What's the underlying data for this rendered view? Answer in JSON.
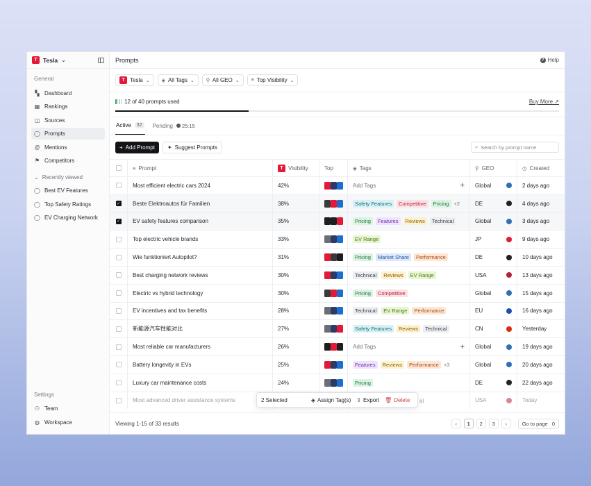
{
  "sidebar": {
    "org": {
      "name": "Tesla",
      "logo_letter": "T"
    },
    "general_title": "General",
    "nav": [
      {
        "label": "Dashboard",
        "icon": "dashboard-icon",
        "glyph": "▚"
      },
      {
        "label": "Rankings",
        "icon": "rankings-icon",
        "glyph": "▦"
      },
      {
        "label": "Sources",
        "icon": "sources-icon",
        "glyph": "◫"
      },
      {
        "label": "Prompts",
        "icon": "chat-icon",
        "glyph": "◯",
        "active": true
      },
      {
        "label": "Mentions",
        "icon": "at-icon",
        "glyph": "@"
      },
      {
        "label": "Competitors",
        "icon": "flag-icon",
        "glyph": "⚑"
      }
    ],
    "recent_title": "Recently viewed",
    "recent": [
      {
        "label": "Best EV Features"
      },
      {
        "label": "Top Safety Ratings"
      },
      {
        "label": "EV Charging Network"
      }
    ],
    "settings_title": "Settings",
    "settings": [
      {
        "label": "Team",
        "icon": "team-icon",
        "glyph": "⚇"
      },
      {
        "label": "Workspace",
        "icon": "globe-icon",
        "glyph": "◍"
      }
    ]
  },
  "header": {
    "title": "Prompts",
    "help_label": "Help"
  },
  "filters": [
    {
      "label": "Tesla",
      "icon": "tesla-logo-icon"
    },
    {
      "label": "All Tags",
      "icon": "tag-icon"
    },
    {
      "label": "All GEO",
      "icon": "pin-icon"
    },
    {
      "label": "Top Visibility",
      "icon": "sort-icon"
    }
  ],
  "usage": {
    "text": "12 of 40 prompts used",
    "used": 12,
    "total": 40,
    "buy_more": "Buy More ↗"
  },
  "tabs": [
    {
      "label": "Active",
      "count": "32"
    },
    {
      "label": "Pending",
      "timer": "25:15"
    }
  ],
  "actions": {
    "add_prompt": "Add Prompt",
    "suggest_prompts": "Suggest Prompts",
    "search_placeholder": "Search by prompt name"
  },
  "table": {
    "headers": {
      "prompt": "Prompt",
      "visibility": "Visibility",
      "top": "Top",
      "tags": "Tags",
      "geo": "GEO",
      "created": "Created"
    },
    "add_tags_label": "Add Tags",
    "rows": [
      {
        "prompt": "Most efficient electric cars 2024",
        "visibility": "42%",
        "brands": [
          "#e31937",
          "#2b3a67",
          "#1b6fd1"
        ],
        "tags": [],
        "more": "",
        "geo": "Global",
        "flag": "#2f6fb5",
        "created": "2 days ago",
        "checked": false
      },
      {
        "prompt": "Beste Elektroautos für Familien",
        "visibility": "38%",
        "brands": [
          "#3a3a3a",
          "#e31937",
          "#1b6fd1"
        ],
        "tags": [
          "Safety Features",
          "Competitive",
          "Pricing"
        ],
        "more": "+2",
        "geo": "DE",
        "flag": "#222222",
        "created": "4 days ago",
        "checked": true
      },
      {
        "prompt": "EV safety features comparison",
        "visibility": "35%",
        "brands": [
          "#1e1e1e",
          "#1e1e1e",
          "#e31937"
        ],
        "tags": [
          "Pricing",
          "Features",
          "Reviews",
          "Technical"
        ],
        "more": "",
        "geo": "Global",
        "flag": "#2f6fb5",
        "created": "3 days ago",
        "checked": true
      },
      {
        "prompt": "Top electric vehicle brands",
        "visibility": "33%",
        "brands": [
          "#6b6f75",
          "#2b3a67",
          "#1b6fd1"
        ],
        "tags": [
          "EV Range"
        ],
        "more": "",
        "geo": "JP",
        "flag": "#e31937",
        "created": "9 days ago",
        "checked": false
      },
      {
        "prompt": "Wie funktioniert Autopilot?",
        "visibility": "31%",
        "brands": [
          "#e31937",
          "#3a3a3a",
          "#1e1e1e"
        ],
        "tags": [
          "Pricing",
          "Market Share",
          "Performance"
        ],
        "more": "",
        "geo": "DE",
        "flag": "#222222",
        "created": "10 days ago",
        "checked": false
      },
      {
        "prompt": "Best charging network reviews",
        "visibility": "30%",
        "brands": [
          "#e31937",
          "#2b3a67",
          "#1b6fd1"
        ],
        "tags": [
          "Technical",
          "Reviews",
          "EV Range"
        ],
        "more": "",
        "geo": "USA",
        "flag": "#b22234",
        "created": "13 days ago",
        "checked": false
      },
      {
        "prompt": "Electric vs hybrid technology",
        "visibility": "30%",
        "brands": [
          "#3a3a3a",
          "#e31937",
          "#1b6fd1"
        ],
        "tags": [
          "Pricing",
          "Competitive"
        ],
        "more": "",
        "geo": "Global",
        "flag": "#2f6fb5",
        "created": "15 days ago",
        "checked": false
      },
      {
        "prompt": "EV incentives and tax benefits",
        "visibility": "28%",
        "brands": [
          "#6b6f75",
          "#2b3a67",
          "#1b6fd1"
        ],
        "tags": [
          "Technical",
          "EV Range",
          "Performance"
        ],
        "more": "",
        "geo": "EU",
        "flag": "#1f4fa8",
        "created": "16 days ago",
        "checked": false
      },
      {
        "prompt": "新能源汽车性能对比",
        "visibility": "27%",
        "brands": [
          "#6b6f75",
          "#2b3a67",
          "#e31937"
        ],
        "tags": [
          "Safety Features",
          "Reviews",
          "Technical"
        ],
        "more": "",
        "geo": "CN",
        "flag": "#de2910",
        "created": "Yesterday",
        "checked": false
      },
      {
        "prompt": "Most reliable car manufacturers",
        "visibility": "26%",
        "brands": [
          "#1e1e1e",
          "#e31937",
          "#1e1e1e"
        ],
        "tags": [],
        "more": "",
        "geo": "Global",
        "flag": "#2f6fb5",
        "created": "19 days ago",
        "checked": false
      },
      {
        "prompt": "Battery longevity in EVs",
        "visibility": "25%",
        "brands": [
          "#e31937",
          "#2b3a67",
          "#1b6fd1"
        ],
        "tags": [
          "Features",
          "Reviews",
          "Performance"
        ],
        "more": "+3",
        "geo": "Global",
        "flag": "#2f6fb5",
        "created": "20 days ago",
        "checked": false
      },
      {
        "prompt": "Luxury car maintenance costs",
        "visibility": "24%",
        "brands": [
          "#6b6f75",
          "#2b3a67",
          "#1b6fd1"
        ],
        "tags": [
          "Pricing"
        ],
        "more": "",
        "geo": "DE",
        "flag": "#222222",
        "created": "22 days ago",
        "checked": false
      },
      {
        "prompt": "Most advanced driver assistance systems",
        "visibility": "",
        "brands": [],
        "tags": [],
        "more": "",
        "geo": "USA",
        "flag": "#b22234",
        "created": "Today",
        "checked": false,
        "faded": true
      }
    ]
  },
  "tag_colors": {
    "Safety Features": {
      "bg": "#d8f1f4",
      "fg": "#13707d"
    },
    "Competitive": {
      "bg": "#fbe0e4",
      "fg": "#b3243d"
    },
    "Pricing": {
      "bg": "#dcf3e3",
      "fg": "#1d7a3e"
    },
    "Features": {
      "bg": "#efe3fb",
      "fg": "#6f2fb0"
    },
    "Reviews": {
      "bg": "#fdf1cf",
      "fg": "#8a6200"
    },
    "Technical": {
      "bg": "#eceef1",
      "fg": "#3d4249"
    },
    "EV Range": {
      "bg": "#e8f5d2",
      "fg": "#4b7d12"
    },
    "Market Share": {
      "bg": "#dde9fb",
      "fg": "#24549c"
    },
    "Performance": {
      "bg": "#fde6d6",
      "fg": "#a54a10"
    }
  },
  "selection": {
    "count_label": "2 Selected",
    "assign_label": "Assign Tag(s)",
    "export_label": "Export",
    "delete_label": "Delete",
    "peek_label": "al"
  },
  "footer": {
    "viewing": "Viewing 1-15 of 33 results",
    "pages": [
      "1",
      "2",
      "3"
    ],
    "current_page": "1",
    "goto_label": "Go to page",
    "goto_value": "0"
  }
}
